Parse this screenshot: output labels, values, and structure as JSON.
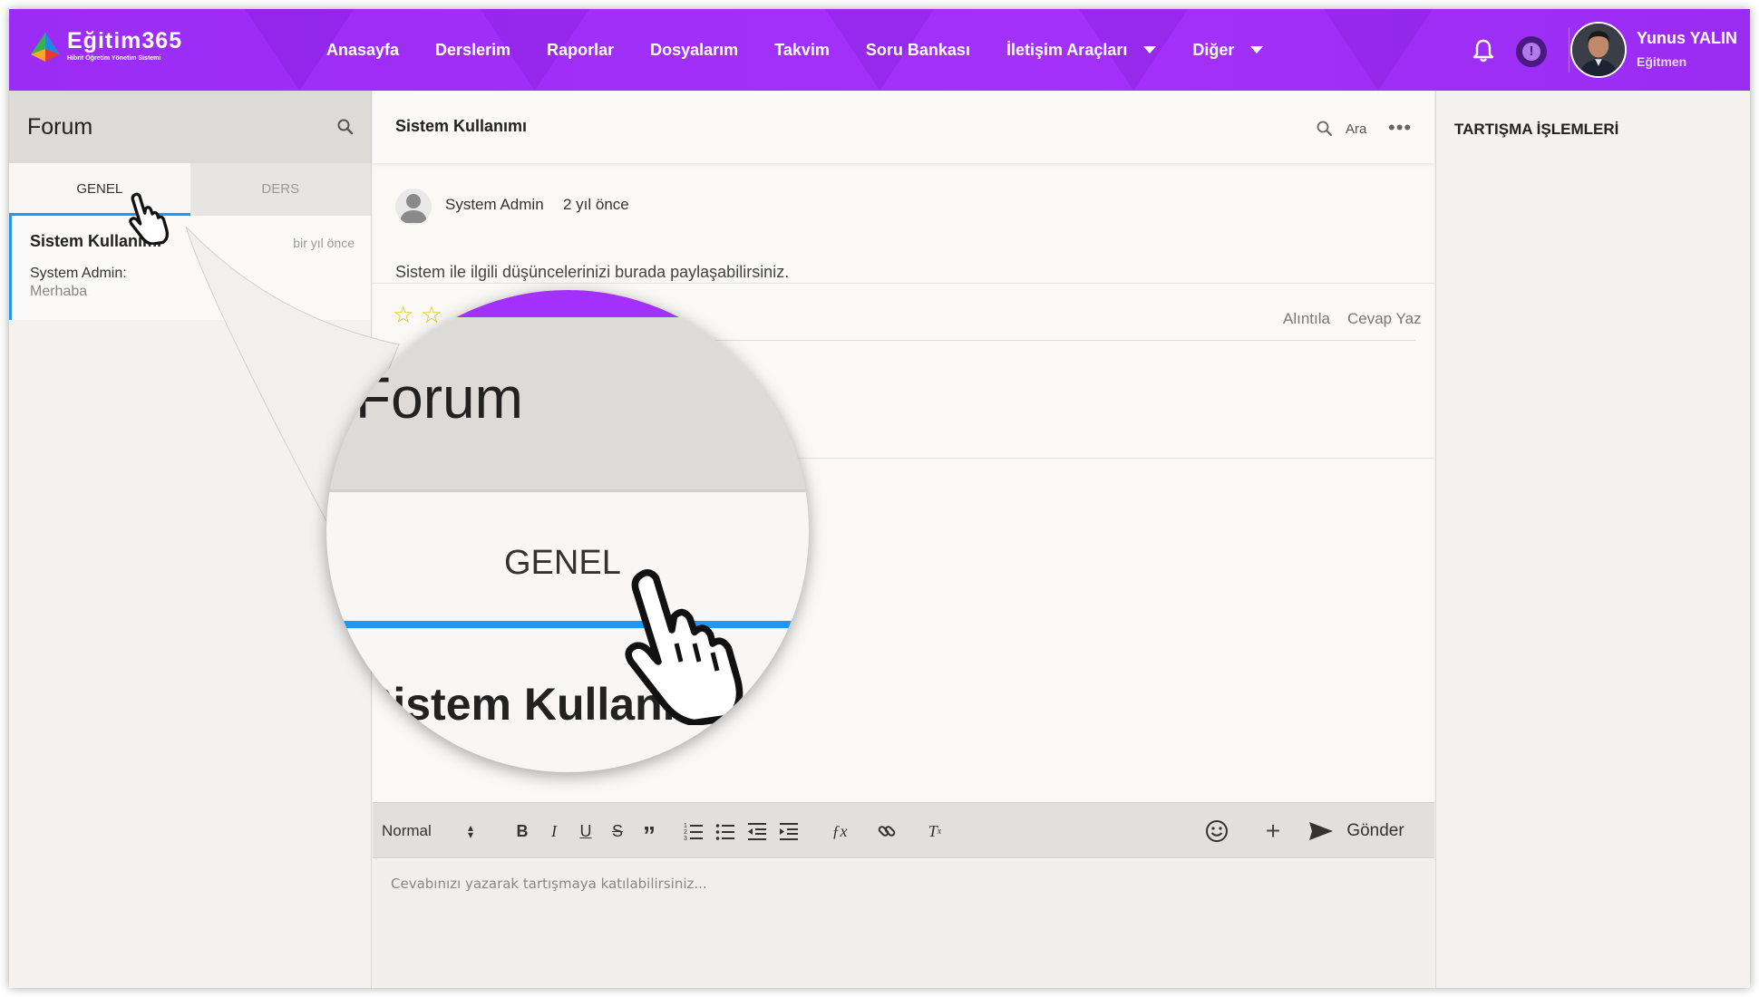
{
  "brand": {
    "name": "Eğitim365",
    "subtitle": "Hibrit Öğretim Yönetim Sistemi"
  },
  "nav": {
    "items": [
      {
        "label": "Anasayfa",
        "has_caret": false
      },
      {
        "label": "Derslerim",
        "has_caret": false
      },
      {
        "label": "Raporlar",
        "has_caret": false
      },
      {
        "label": "Dosyalarım",
        "has_caret": false
      },
      {
        "label": "Takvim",
        "has_caret": false
      },
      {
        "label": "Soru Bankası",
        "has_caret": false
      },
      {
        "label": "İletişim Araçları",
        "has_caret": true
      },
      {
        "label": "Diğer",
        "has_caret": true
      }
    ]
  },
  "user": {
    "name": "Yunus YALIN",
    "role": "Eğitmen",
    "alert_symbol": "!"
  },
  "forum": {
    "title": "Forum",
    "tabs": [
      {
        "label": "GENEL",
        "active": true
      },
      {
        "label": "DERS",
        "active": false
      }
    ],
    "threads": [
      {
        "title": "Sistem Kullanımı",
        "time": "bir yıl önce",
        "author": "System Admin:",
        "message": "Merhaba"
      }
    ]
  },
  "discussion": {
    "title": "Sistem Kullanımı",
    "search_label": "Ara",
    "more": "•••",
    "post": {
      "author": "System Admin",
      "time": "2 yıl önce",
      "body": "Sistem ile ilgili düşüncelerinizi burada paylaşabilirsiniz.",
      "quote_label": "Alıntıla",
      "reply_label": "Cevap Yaz"
    }
  },
  "editor": {
    "format_value": "Normal",
    "send_label": "Gönder",
    "placeholder": "Cevabınızı yazarak tartışmaya katılabilirsiniz..."
  },
  "sidebar_right": {
    "title": "TARTIŞMA İŞLEMLERİ"
  },
  "magnifier": {
    "title": "Forum",
    "tab": "GENEL",
    "thread": "Sistem Kullanımı"
  },
  "colors": {
    "brand_purple": "#a331fb",
    "active_tab": "#2196f3",
    "star": "#e6c200"
  }
}
